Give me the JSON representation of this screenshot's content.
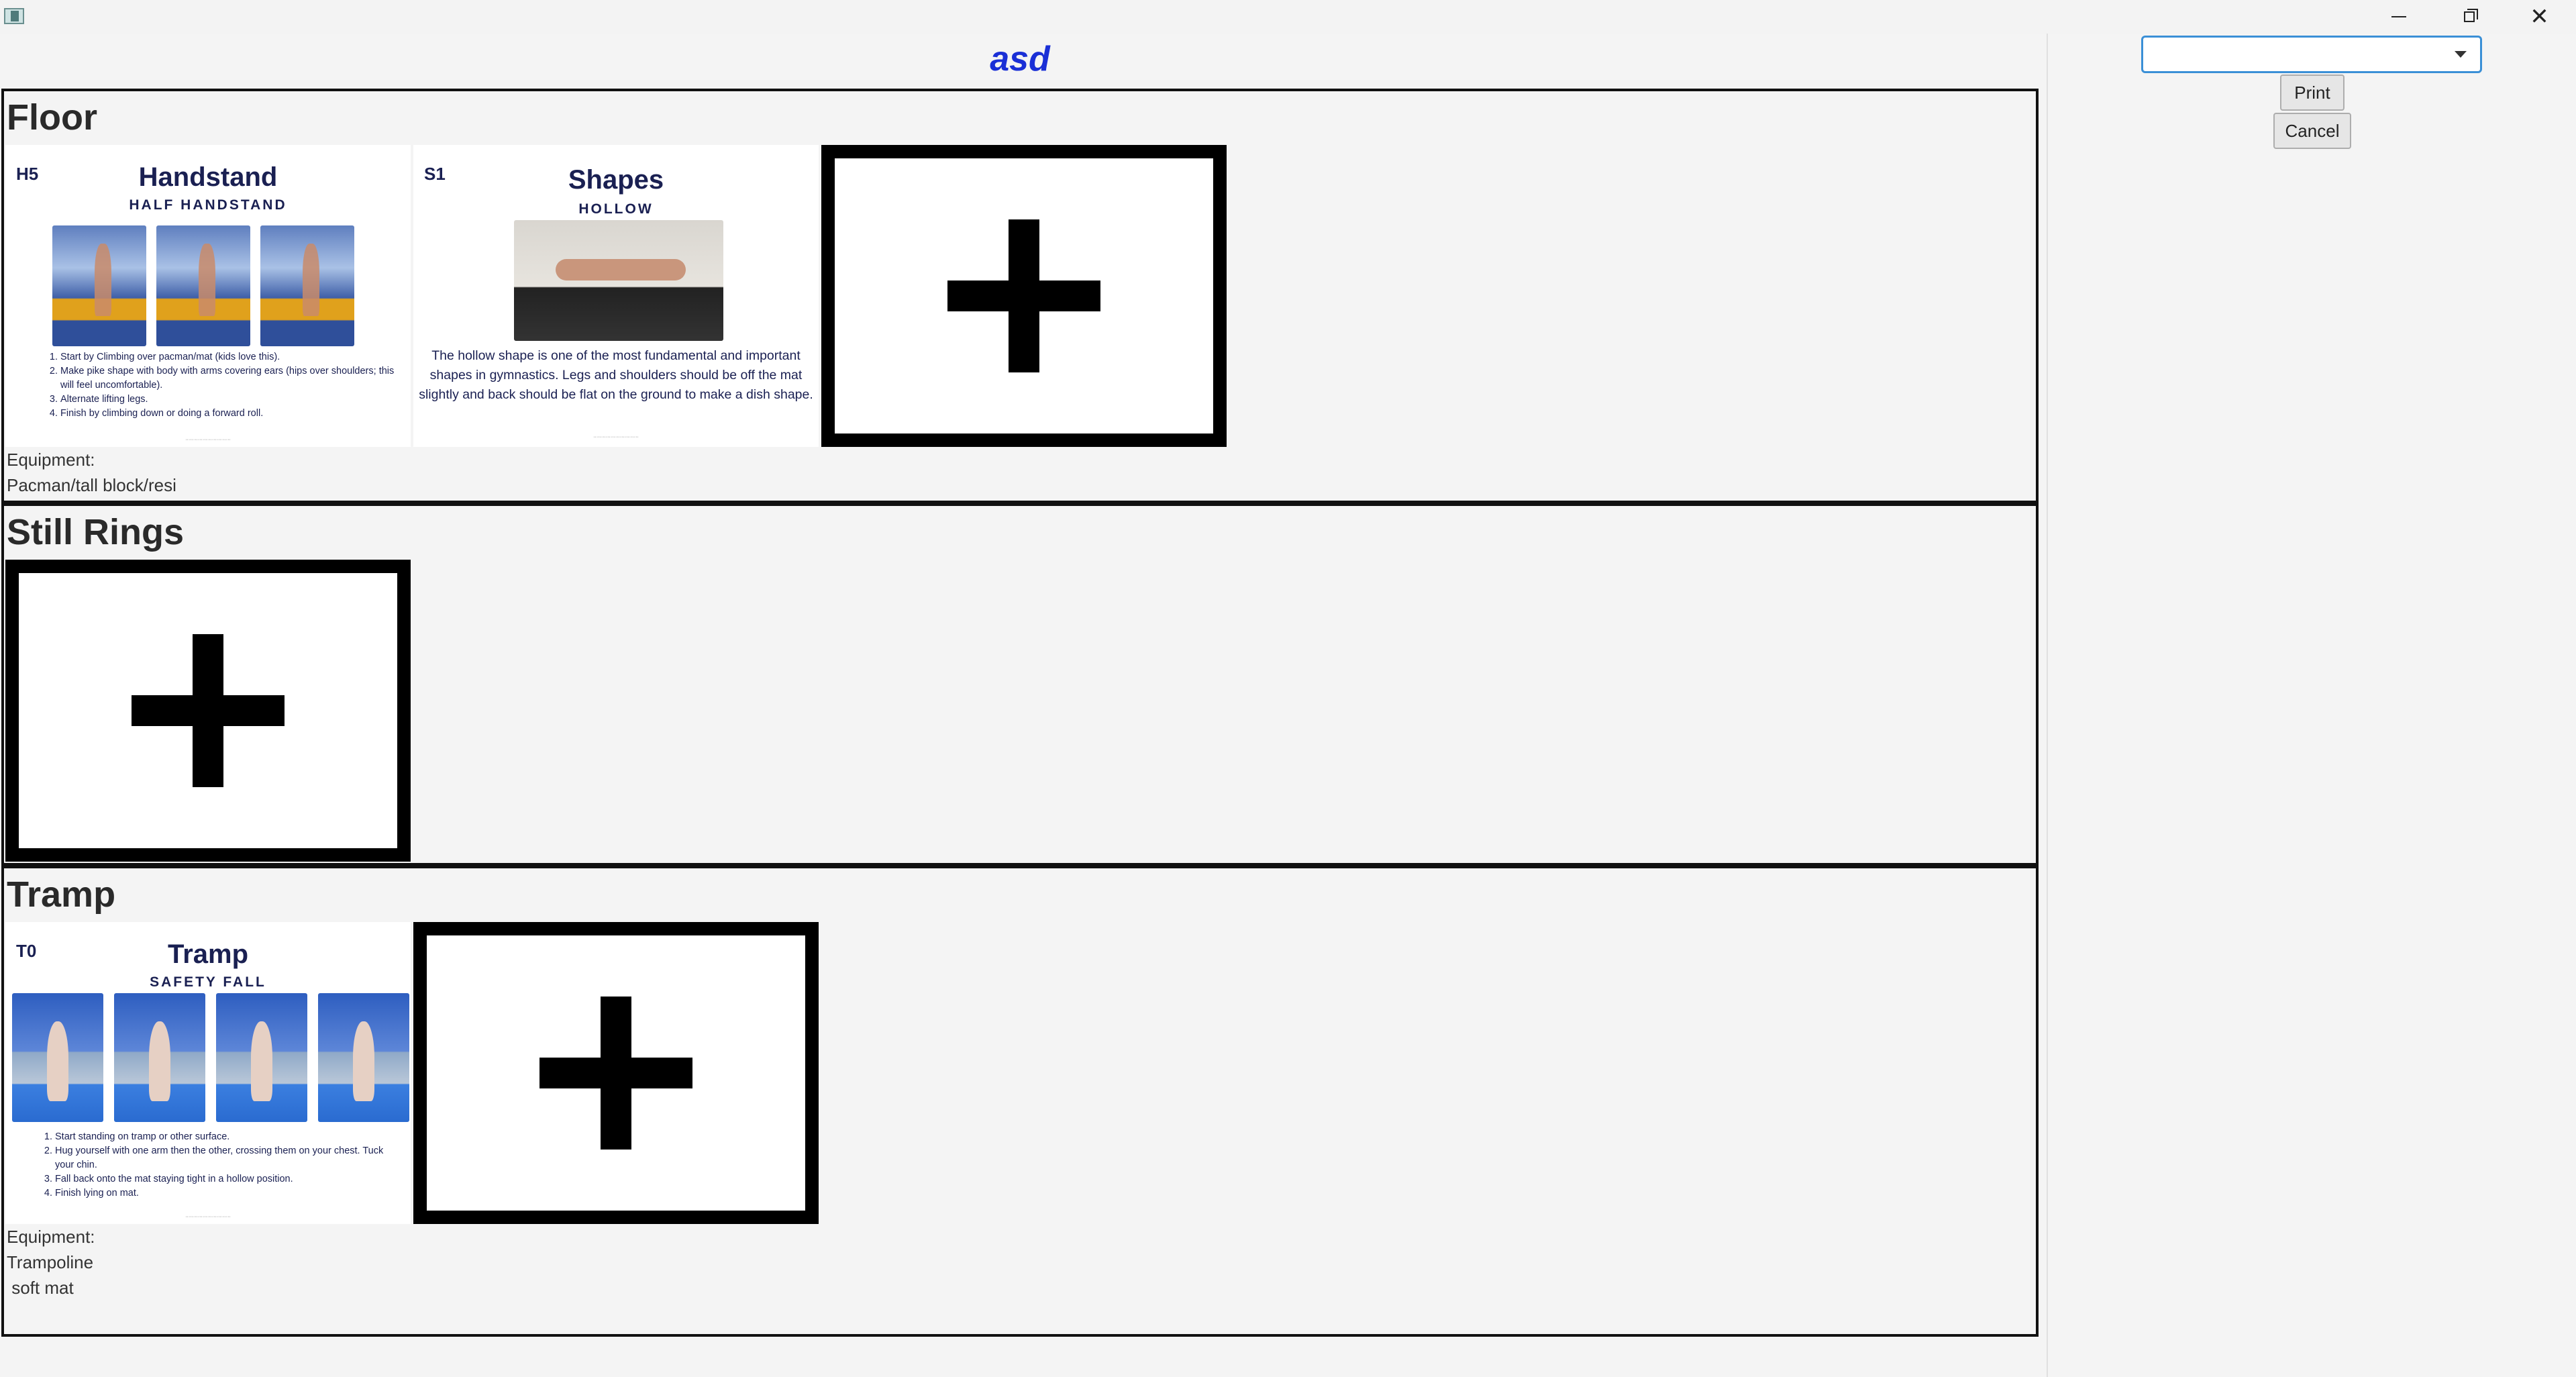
{
  "window": {
    "close_glyph": "✕"
  },
  "report": {
    "title": "asd"
  },
  "controls": {
    "select_value": "",
    "print_label": "Print",
    "cancel_label": "Cancel"
  },
  "sections": {
    "floor": {
      "title": "Floor",
      "card1": {
        "code": "H5",
        "title": "Handstand",
        "subtitle": "HALF HANDSTAND",
        "steps": [
          "Start by Climbing over pacman/mat (kids love this).",
          "Make pike shape with body with arms covering ears (hips over shoulders; this will feel uncomfortable).",
          "Alternate lifting legs.",
          "Finish by climbing down or doing a forward roll."
        ]
      },
      "card2": {
        "code": "S1",
        "title": "Shapes",
        "subtitle": "HOLLOW",
        "text": "The hollow shape is one of the most fundamental and important shapes in gymnastics. Legs and shoulders should be off the mat slightly and back should be flat on the ground to make a dish shape."
      },
      "equipment_label": "Equipment:",
      "equipment_lines": [
        "Pacman/tall block/resi"
      ]
    },
    "rings": {
      "title": "Still Rings"
    },
    "tramp": {
      "title": "Tramp",
      "card1": {
        "code": "T0",
        "title": "Tramp",
        "subtitle": "SAFETY FALL",
        "steps": [
          "Start standing on tramp or other surface.",
          "Hug yourself with one arm then the other, crossing them on your chest. Tuck your chin.",
          "Fall back onto the mat staying tight in a hollow position.",
          "Finish lying on mat."
        ]
      },
      "equipment_label": "Equipment:",
      "equipment_lines": [
        "Trampoline",
        " soft mat"
      ]
    }
  }
}
